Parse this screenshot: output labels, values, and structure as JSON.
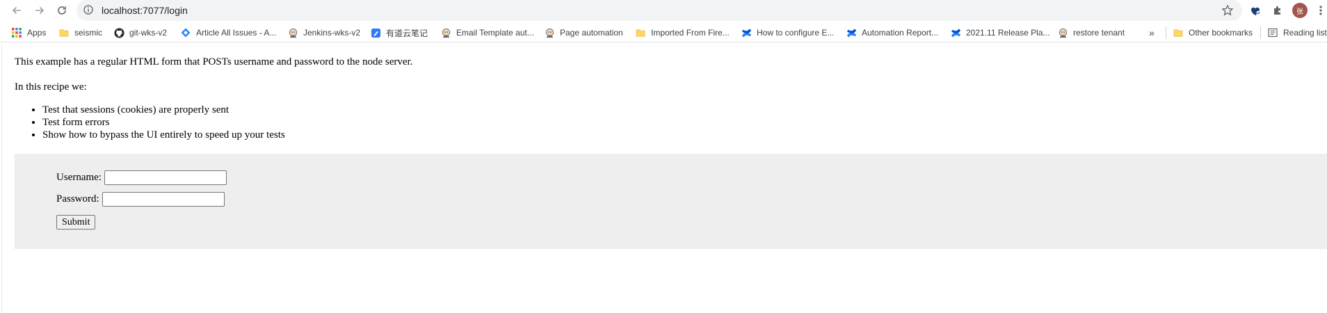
{
  "browser": {
    "url": "localhost:7077/login",
    "bookmarks": [
      {
        "label": "Apps",
        "icon": "apps-grid-icon"
      },
      {
        "label": "seismic",
        "icon": "folder-icon"
      },
      {
        "label": "git-wks-v2",
        "icon": "github-icon"
      },
      {
        "label": "Article All Issues - A...",
        "icon": "jira-icon"
      },
      {
        "label": "Jenkins-wks-v2",
        "icon": "jenkins-icon"
      },
      {
        "label": "有道云笔记",
        "icon": "youdao-note-icon"
      },
      {
        "label": "Email Template aut...",
        "icon": "jenkins-icon"
      },
      {
        "label": "Page automation",
        "icon": "jenkins-icon"
      },
      {
        "label": "Imported From Fire...",
        "icon": "folder-icon"
      },
      {
        "label": "How to configure E...",
        "icon": "confluence-icon"
      },
      {
        "label": "Automation Report...",
        "icon": "confluence-icon"
      },
      {
        "label": "2021.11 Release Pla...",
        "icon": "confluence-icon"
      },
      {
        "label": "restore tenant",
        "icon": "jenkins-icon"
      }
    ],
    "overflow_label": "»",
    "other_bookmarks": "Other bookmarks",
    "reading_list": "Reading list",
    "avatar_text": "张"
  },
  "page": {
    "intro": "This example has a regular HTML form that POSTs username and password to the node server.",
    "recipe_heading": "In this recipe we:",
    "recipe_items": [
      "Test that sessions (cookies) are properly sent",
      "Test form errors",
      "Show how to bypass the UI entirely to speed up your tests"
    ],
    "form": {
      "username_label": "Username:",
      "username_value": "",
      "password_label": "Password:",
      "password_value": "",
      "submit_label": "Submit"
    }
  },
  "colors": {
    "form_background": "#eeeeee",
    "omnibox_background": "#f1f3f4",
    "avatar": "#a1574a"
  }
}
